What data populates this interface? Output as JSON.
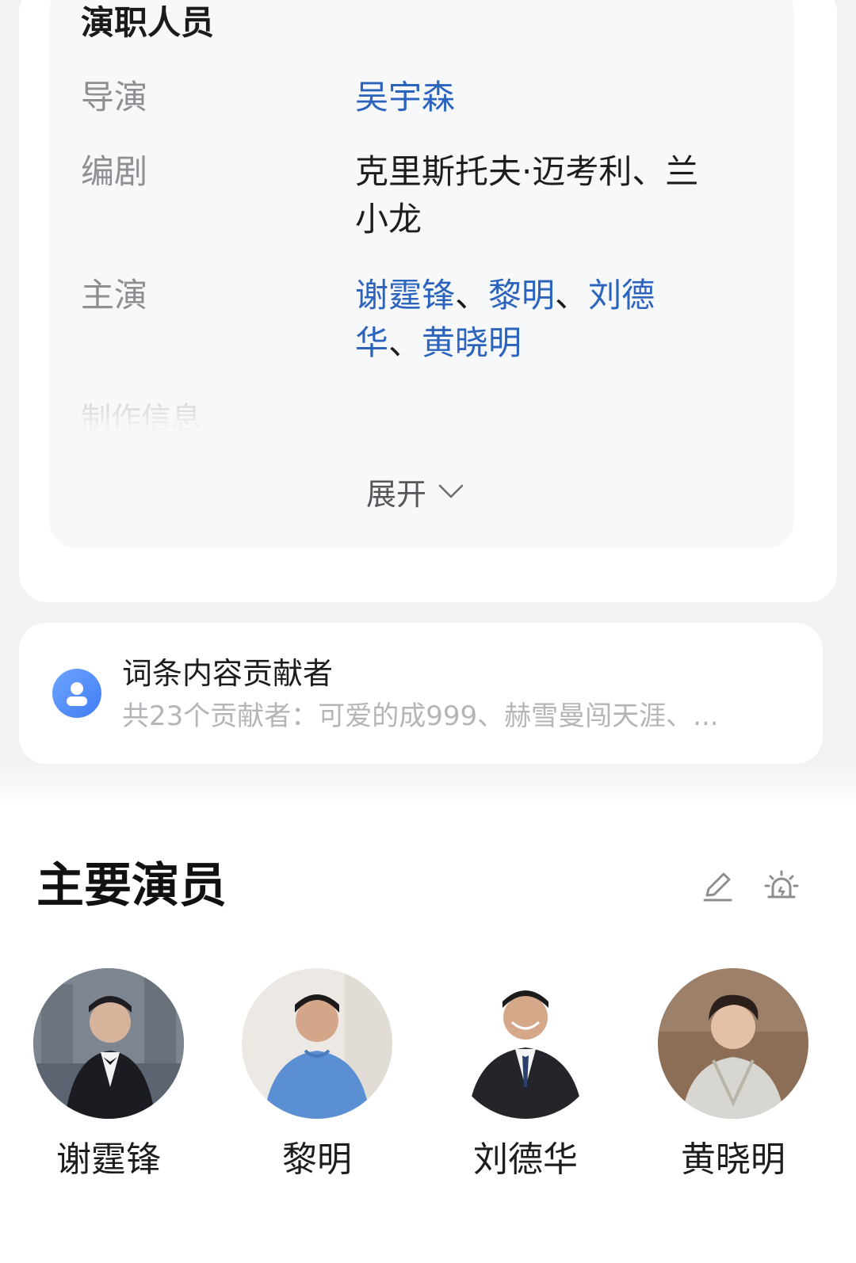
{
  "credits": {
    "heading": "演职人员",
    "director": {
      "label": "导演",
      "names": [
        "吴宇森"
      ]
    },
    "writer": {
      "label": "编剧",
      "names_line1": "克里斯托夫·迈考利、兰",
      "names_line2": "小龙"
    },
    "starring": {
      "label": "主演",
      "names": [
        "谢霆锋",
        "黎明",
        "刘德华",
        "黄晓明"
      ],
      "separator": "、"
    },
    "faded_label": "制作信息",
    "expand_label": "展开"
  },
  "contributors": {
    "title": "词条内容贡献者",
    "summary": "共23个贡献者：可爱的成999、赫雪曼闯天涯、..."
  },
  "cast_section": {
    "title": "主要演员",
    "edit_icon": "pencil-edit-icon",
    "alert_icon": "siren-alert-icon",
    "actors": [
      {
        "name": "谢霆锋"
      },
      {
        "name": "黎明"
      },
      {
        "name": "刘德华"
      },
      {
        "name": "黄晓明"
      }
    ]
  },
  "colors": {
    "link": "#2c64bd",
    "label": "#8d8f93",
    "page_bg": "#f1f2f4"
  }
}
